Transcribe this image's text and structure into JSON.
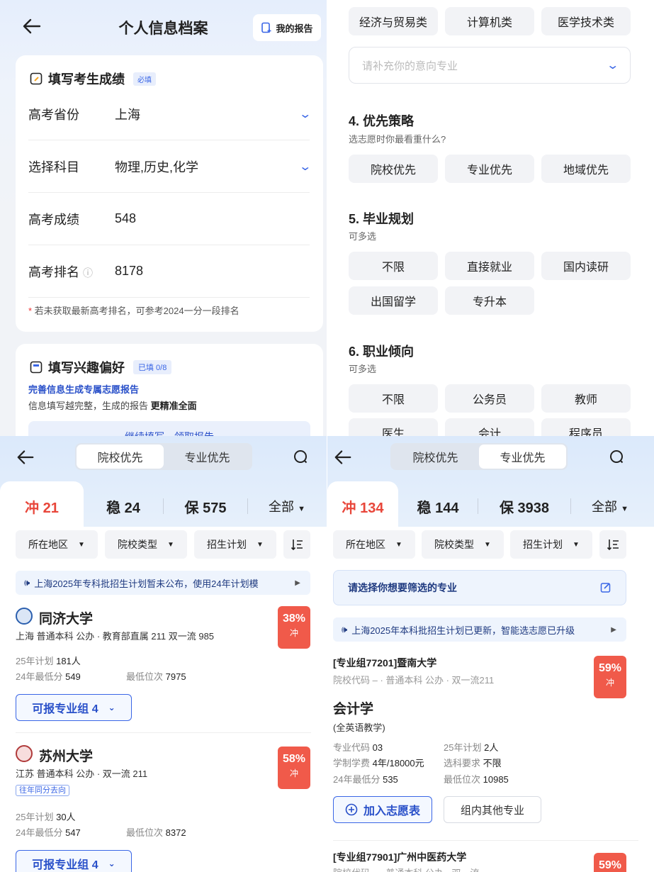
{
  "p1": {
    "title": "个人信息档案",
    "report_btn": "我的报告",
    "score_card": {
      "title": "填写考生成绩",
      "tag": "必填",
      "rows": [
        {
          "label": "高考省份",
          "value": "上海"
        },
        {
          "label": "选择科目",
          "value": "物理,历史,化学"
        },
        {
          "label": "高考成绩",
          "value": "548"
        },
        {
          "label": "高考排名",
          "value": "8178"
        }
      ],
      "note_star": "*",
      "note": " 若未获取最新高考排名，可参考2024一分一段排名"
    },
    "interest": {
      "title": "填写兴趣偏好",
      "tag": "已填 0/8",
      "link": "完善信息生成专属志愿报告",
      "desc": "信息填写越完整，生成的报告 ",
      "desc_bold": "更精准全面",
      "btn": "继续填写，领取报告"
    }
  },
  "p2": {
    "top_chips": [
      "经济与贸易类",
      "计算机类",
      "医学技术类"
    ],
    "input_placeholder": "请补充你的意向专业",
    "s4": {
      "title": "4. 优先策略",
      "sub": "选志愿时你最看重什么?",
      "chips": [
        "院校优先",
        "专业优先",
        "地域优先"
      ]
    },
    "s5": {
      "title": "5. 毕业规划",
      "sub": "可多选",
      "chips": [
        "不限",
        "直接就业",
        "国内读研",
        "出国留学",
        "专升本"
      ]
    },
    "s6": {
      "title": "6. 职业倾向",
      "sub": "可多选",
      "chips": [
        "不限",
        "公务员",
        "教师",
        "医生",
        "会计",
        "程序员"
      ]
    }
  },
  "p3": {
    "seg": [
      "院校优先",
      "专业优先"
    ],
    "stats": {
      "chong_label": "冲",
      "chong": "21",
      "wen_label": "稳",
      "wen": "24",
      "bao_label": "保",
      "bao": "575",
      "all": "全部"
    },
    "filters": [
      "所在地区",
      "院校类型",
      "招生计划"
    ],
    "notice": "上海2025年专科批招生计划暂未公布，使用24年计划模",
    "schools": [
      {
        "name": "同济大学",
        "meta": "上海 普通本科 公办 · 教育部直属 211 双一流 985",
        "plan_label": "25年计划",
        "plan": "181人",
        "min_label": "24年最低分",
        "min": "549",
        "rank_label": "最低位次",
        "rank": "7975",
        "pct": "38%",
        "tier": "冲",
        "btn": "可报专业组 4"
      },
      {
        "name": "苏州大学",
        "meta": "江苏 普通本科 公办 · 双一流 211",
        "tag": "往年同分去向",
        "plan_label": "25年计划",
        "plan": "30人",
        "min_label": "24年最低分",
        "min": "547",
        "rank_label": "最低位次",
        "rank": "8372",
        "pct": "58%",
        "tier": "冲",
        "btn": "可报专业组 4"
      }
    ]
  },
  "p4": {
    "seg": [
      "院校优先",
      "专业优先"
    ],
    "stats": {
      "chong_label": "冲",
      "chong": "134",
      "wen_label": "稳",
      "wen": "144",
      "bao_label": "保",
      "bao": "3938",
      "all": "全部"
    },
    "filters": [
      "所在地区",
      "院校类型",
      "招生计划"
    ],
    "pick": "请选择你想要筛选的专业",
    "notice": "上海2025年本科批招生计划已更新，智能选志愿已升级",
    "group1": {
      "head": "[专业组77201]暨南大学",
      "meta": "院校代码 – · 普通本科 公办 · 双一流211",
      "pct": "59%",
      "tier": "冲",
      "major": "会计学",
      "note": "(全英语教学)",
      "code_label": "专业代码",
      "code": "03",
      "plan_label": "25年计划",
      "plan": "2人",
      "fee_label": "学制学费",
      "fee": "4年/18000元",
      "req_label": "选科要求",
      "req": "不限",
      "min_label": "24年最低分",
      "min": "535",
      "rank_label": "最低位次",
      "rank": "10985",
      "add": "加入志愿表",
      "other": "组内其他专业"
    },
    "group2": {
      "head": "[专业组77901]广州中医药大学",
      "meta": "院校代码 – · 普通本科 公办 · 双一流",
      "pct": "59%"
    }
  },
  "colors": {
    "accent": "#3a66e6",
    "red": "#f05a4a"
  }
}
